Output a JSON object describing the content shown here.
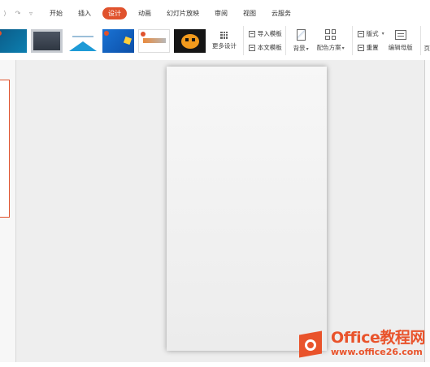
{
  "quick_access": {
    "icons": [
      "redo-arrow-icon",
      "undo-arrow-icon",
      "dropdown-menu-icon"
    ],
    "glyphs": [
      "⟩",
      "↷",
      "▿"
    ]
  },
  "menu": {
    "tabs": [
      {
        "label": "开始",
        "active": false
      },
      {
        "label": "插入",
        "active": false
      },
      {
        "label": "设计",
        "active": true
      },
      {
        "label": "动画",
        "active": false
      },
      {
        "label": "幻灯片放映",
        "active": false
      },
      {
        "label": "审阅",
        "active": false
      },
      {
        "label": "视图",
        "active": false
      },
      {
        "label": "云服务",
        "active": false
      }
    ]
  },
  "ribbon": {
    "more_design": "更多设计",
    "import_template": "导入模板",
    "current_template": "本文模板",
    "background": "背景",
    "color_scheme": "配色方案",
    "layout": "版式",
    "reset": "重置",
    "edit_master": "编辑母版",
    "cut_off": "页"
  },
  "watermark": {
    "title": "Office教程网",
    "url": "www.office26.com"
  },
  "colors": {
    "accent": "#e0522d",
    "watermark": "#e9532b",
    "workspace_bg": "#eeeeee"
  }
}
